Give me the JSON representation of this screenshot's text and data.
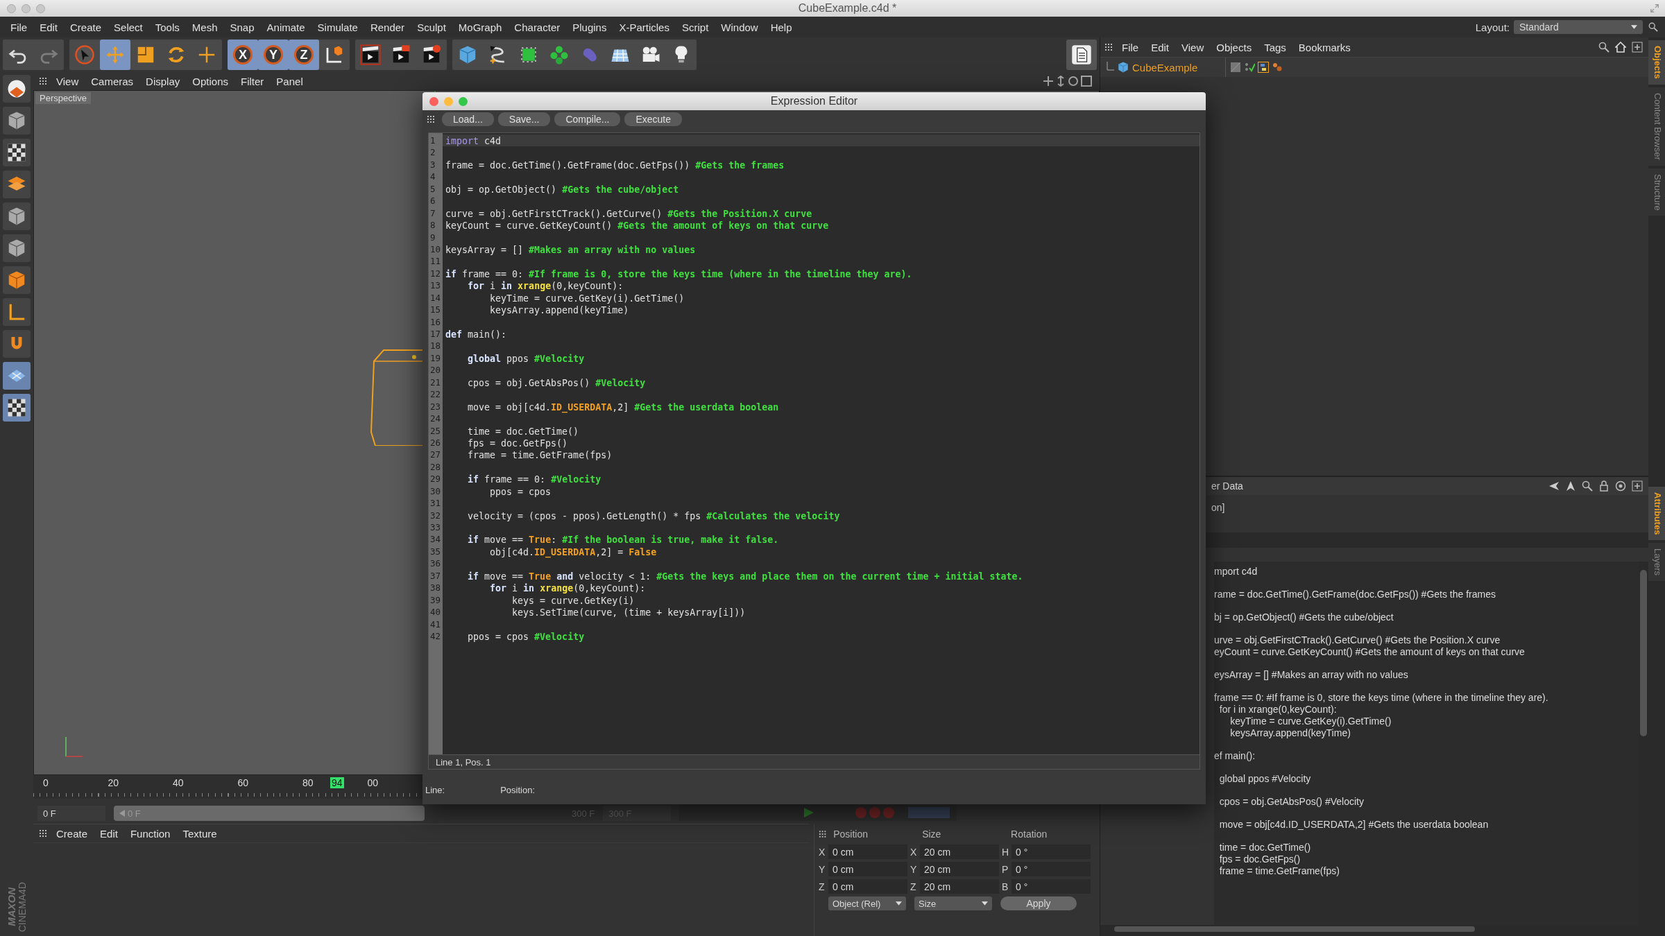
{
  "title_bar": {
    "title": "CubeExample.c4d *"
  },
  "menu_bar": {
    "items": [
      "File",
      "Edit",
      "Create",
      "Select",
      "Tools",
      "Mesh",
      "Snap",
      "Animate",
      "Simulate",
      "Render",
      "Sculpt",
      "MoGraph",
      "Character",
      "Plugins",
      "X-Particles",
      "Script",
      "Window",
      "Help"
    ],
    "layout_label": "Layout:",
    "layout_value": "Standard"
  },
  "toolbar": {
    "groups": [
      [
        {
          "kind": "undo",
          "selected": false,
          "disabled": false
        },
        {
          "kind": "redo",
          "selected": false,
          "disabled": true
        }
      ],
      [
        {
          "kind": "select",
          "selected": false,
          "disabled": false
        },
        {
          "kind": "move",
          "selected": true,
          "disabled": false
        },
        {
          "kind": "scale",
          "selected": false,
          "disabled": false
        },
        {
          "kind": "rotate",
          "selected": false,
          "disabled": false
        },
        {
          "kind": "transform",
          "selected": false,
          "disabled": false
        }
      ],
      [
        {
          "kind": "axis",
          "label": "X",
          "selected": true,
          "disabled": false
        },
        {
          "kind": "axis",
          "label": "Y",
          "selected": true,
          "disabled": false
        },
        {
          "kind": "axis",
          "label": "Z",
          "selected": true,
          "disabled": false
        },
        {
          "kind": "coords",
          "selected": false,
          "disabled": false
        }
      ],
      [
        {
          "kind": "render-view",
          "selected": false,
          "disabled": false
        },
        {
          "kind": "render-picture",
          "selected": false,
          "disabled": false
        },
        {
          "kind": "render-settings",
          "selected": false,
          "disabled": false
        }
      ],
      [
        {
          "kind": "cube",
          "selected": false,
          "disabled": false
        },
        {
          "kind": "pen",
          "selected": false,
          "disabled": false
        },
        {
          "kind": "subdivision",
          "selected": false,
          "disabled": false
        },
        {
          "kind": "cloner",
          "selected": false,
          "disabled": false
        },
        {
          "kind": "deformer",
          "selected": false,
          "disabled": false
        },
        {
          "kind": "floor",
          "selected": false,
          "disabled": false
        },
        {
          "kind": "camera",
          "selected": false,
          "disabled": false
        },
        {
          "kind": "light",
          "selected": false,
          "disabled": false
        }
      ]
    ]
  },
  "viewport": {
    "menu": [
      "View",
      "Cameras",
      "Display",
      "Options",
      "Filter",
      "Panel"
    ],
    "label": "Perspective"
  },
  "timeline": {
    "ticks": [
      "0",
      "20",
      "40",
      "60",
      "80",
      "00"
    ],
    "marker": "94",
    "start_field": "0 F",
    "slider_value": "0 F",
    "level": 1,
    "end_slider": "300 F",
    "end_field": "300 F"
  },
  "material_manager": {
    "menu": [
      "Create",
      "Edit",
      "Function",
      "Texture"
    ]
  },
  "logo": {
    "brand": "MAXON",
    "product": "CINEMA4D"
  },
  "coordinates": {
    "headers": [
      "Position",
      "Size",
      "Rotation"
    ],
    "rows": [
      {
        "axis": "X",
        "position": "0 cm",
        "size_axis": "X",
        "size": "20 cm",
        "rot_axis": "H",
        "rotation": "0 °"
      },
      {
        "axis": "Y",
        "position": "0 cm",
        "size_axis": "Y",
        "size": "20 cm",
        "rot_axis": "P",
        "rotation": "0 °"
      },
      {
        "axis": "Z",
        "position": "0 cm",
        "size_axis": "Z",
        "size": "20 cm",
        "rot_axis": "B",
        "rotation": "0 °"
      }
    ],
    "mode": "Object (Rel)",
    "size_mode": "Size",
    "apply": "Apply"
  },
  "object_manager": {
    "menu": [
      "File",
      "Edit",
      "View",
      "Objects",
      "Tags",
      "Bookmarks"
    ],
    "objects": [
      {
        "name": "CubeExample",
        "active": true
      }
    ]
  },
  "side_tabs_top": [
    {
      "label": "Objects",
      "selected": true
    },
    {
      "label": "Content Browser",
      "selected": false
    },
    {
      "label": "Structure",
      "selected": false
    }
  ],
  "side_tabs_bottom": [
    {
      "label": "Attributes",
      "selected": true
    },
    {
      "label": "Layers",
      "selected": false
    }
  ],
  "attributes": {
    "header": "er Data",
    "field": "on]",
    "code": [
      [
        "mport c4d"
      ],
      [
        "rame = doc.GetTime().GetFrame(doc.GetFps()) #Gets the frames"
      ],
      [
        "bj = op.GetObject() #Gets the cube/object"
      ],
      [
        "urve = obj.GetFirstCTrack().GetCurve() #Gets the Position.X curve",
        "eyCount = curve.GetKeyCount() #Gets the amount of keys on that curve"
      ],
      [
        "eysArray = [] #Makes an array with no values"
      ],
      [
        "frame == 0: #If frame is 0, store the keys time (where in the timeline they are).",
        "  for i in xrange(0,keyCount):",
        "      keyTime = curve.GetKey(i).GetTime()",
        "      keysArray.append(keyTime)"
      ],
      [
        "ef main():"
      ],
      [
        "  global ppos #Velocity"
      ],
      [
        "  cpos = obj.GetAbsPos() #Velocity"
      ],
      [
        "  move = obj[c4d.ID_USERDATA,2] #Gets the userdata boolean"
      ],
      [
        "  time = doc.GetTime()",
        "  fps = doc.GetFps()",
        "  frame = time.GetFrame(fps)"
      ]
    ]
  },
  "editor": {
    "title": "Expression Editor",
    "buttons": [
      "Load...",
      "Save...",
      "Compile...",
      "Execute"
    ],
    "lines": [
      {
        "number": "1",
        "current": true,
        "tokens": [
          {
            "kind": "import",
            "text": "import"
          },
          {
            "kind": "text",
            "text": " c4d"
          }
        ]
      },
      {
        "number": "2",
        "current": false
      },
      {
        "number": "3",
        "current": false,
        "tokens": [
          {
            "kind": "text",
            "text": "frame = doc.GetTime().GetFrame(doc.GetFps()) "
          },
          {
            "kind": "comment",
            "text": "#Gets the frames"
          }
        ]
      },
      {
        "number": "4",
        "current": false
      },
      {
        "number": "5",
        "current": false,
        "tokens": [
          {
            "kind": "text",
            "text": "obj = op.GetObject() "
          },
          {
            "kind": "comment",
            "text": "#Gets the cube/object"
          }
        ]
      },
      {
        "number": "6",
        "current": false
      },
      {
        "number": "7",
        "current": false,
        "tokens": [
          {
            "kind": "text",
            "text": "curve = obj.GetFirstCTrack().GetCurve() "
          },
          {
            "kind": "comment",
            "text": "#Gets the Position.X curve"
          }
        ]
      },
      {
        "number": "8",
        "current": false,
        "tokens": [
          {
            "kind": "text",
            "text": "keyCount = curve.GetKeyCount() "
          },
          {
            "kind": "comment",
            "text": "#Gets the amount of keys on that curve"
          }
        ]
      },
      {
        "number": "9",
        "current": false
      },
      {
        "number": "10",
        "current": false,
        "tokens": [
          {
            "kind": "text",
            "text": "keysArray = [] "
          },
          {
            "kind": "comment",
            "text": "#Makes an array with no values"
          }
        ]
      },
      {
        "number": "11",
        "current": false
      },
      {
        "number": "12",
        "current": false,
        "tokens": [
          {
            "kind": "keyword",
            "text": "if"
          },
          {
            "kind": "text",
            "text": " frame == 0: "
          },
          {
            "kind": "comment",
            "text": "#If frame is 0, store the keys time (where in the timeline they are)."
          }
        ]
      },
      {
        "number": "13",
        "current": false,
        "tokens": [
          {
            "kind": "keyword",
            "text": "    for"
          },
          {
            "kind": "text",
            "text": " i "
          },
          {
            "kind": "keyword",
            "text": "in "
          },
          {
            "kind": "builtin",
            "text": "xrange"
          },
          {
            "kind": "text",
            "text": "(0,keyCount):"
          }
        ]
      },
      {
        "number": "14",
        "current": false,
        "tokens": [
          {
            "kind": "text",
            "text": "        keyTime = curve.GetKey(i).GetTime()"
          }
        ]
      },
      {
        "number": "15",
        "current": false,
        "tokens": [
          {
            "kind": "text",
            "text": "        keysArray.append(keyTime)"
          }
        ]
      },
      {
        "number": "16",
        "current": false
      },
      {
        "number": "17",
        "current": false,
        "tokens": [
          {
            "kind": "keyword",
            "text": "def"
          },
          {
            "kind": "text",
            "text": " main():"
          }
        ]
      },
      {
        "number": "18",
        "current": false
      },
      {
        "number": "19",
        "current": false,
        "tokens": [
          {
            "kind": "keyword",
            "text": "    global"
          },
          {
            "kind": "text",
            "text": " ppos "
          },
          {
            "kind": "comment",
            "text": "#Velocity"
          }
        ]
      },
      {
        "number": "20",
        "current": false
      },
      {
        "number": "21",
        "current": false,
        "tokens": [
          {
            "kind": "text",
            "text": "    cpos = obj.GetAbsPos() "
          },
          {
            "kind": "comment",
            "text": "#Velocity"
          }
        ]
      },
      {
        "number": "22",
        "current": false
      },
      {
        "number": "23",
        "current": false,
        "tokens": [
          {
            "kind": "text",
            "text": "    move = obj[c4d."
          },
          {
            "kind": "constant",
            "text": "ID_USERDATA"
          },
          {
            "kind": "text",
            "text": ",2] "
          },
          {
            "kind": "comment",
            "text": "#Gets the userdata boolean"
          }
        ]
      },
      {
        "number": "24",
        "current": false
      },
      {
        "number": "25",
        "current": false,
        "tokens": [
          {
            "kind": "text",
            "text": "    time = doc.GetTime()"
          }
        ]
      },
      {
        "number": "26",
        "current": false,
        "tokens": [
          {
            "kind": "text",
            "text": "    fps = doc.GetFps()"
          }
        ]
      },
      {
        "number": "27",
        "current": false,
        "tokens": [
          {
            "kind": "text",
            "text": "    frame = time.GetFrame(fps)"
          }
        ]
      },
      {
        "number": "28",
        "current": false
      },
      {
        "number": "29",
        "current": false,
        "tokens": [
          {
            "kind": "keyword",
            "text": "    if"
          },
          {
            "kind": "text",
            "text": " frame == 0: "
          },
          {
            "kind": "comment",
            "text": "#Velocity"
          }
        ]
      },
      {
        "number": "30",
        "current": false,
        "tokens": [
          {
            "kind": "text",
            "text": "        ppos = cpos"
          }
        ]
      },
      {
        "number": "31",
        "current": false
      },
      {
        "number": "32",
        "current": false,
        "tokens": [
          {
            "kind": "text",
            "text": "    velocity = (cpos - ppos).GetLength() * fps "
          },
          {
            "kind": "comment",
            "text": "#Calculates the velocity"
          }
        ]
      },
      {
        "number": "33",
        "current": false
      },
      {
        "number": "34",
        "current": false,
        "tokens": [
          {
            "kind": "keyword",
            "text": "    if"
          },
          {
            "kind": "text",
            "text": " move == "
          },
          {
            "kind": "constant",
            "text": "True"
          },
          {
            "kind": "text",
            "text": ": "
          },
          {
            "kind": "comment",
            "text": "#If the boolean is true, make it false."
          }
        ]
      },
      {
        "number": "35",
        "current": false,
        "tokens": [
          {
            "kind": "text",
            "text": "        obj[c4d."
          },
          {
            "kind": "constant",
            "text": "ID_USERDATA"
          },
          {
            "kind": "text",
            "text": ",2] = "
          },
          {
            "kind": "constant",
            "text": "False"
          }
        ]
      },
      {
        "number": "36",
        "current": false
      },
      {
        "number": "37",
        "current": false,
        "tokens": [
          {
            "kind": "keyword",
            "text": "    if"
          },
          {
            "kind": "text",
            "text": " move == "
          },
          {
            "kind": "constant",
            "text": "True"
          },
          {
            "kind": "keyword",
            "text": " and"
          },
          {
            "kind": "text",
            "text": " velocity < 1: "
          },
          {
            "kind": "comment",
            "text": "#Gets the keys and place them on the current time + initial state."
          }
        ]
      },
      {
        "number": "38",
        "current": false,
        "tokens": [
          {
            "kind": "keyword",
            "text": "        for"
          },
          {
            "kind": "text",
            "text": " i "
          },
          {
            "kind": "keyword",
            "text": "in "
          },
          {
            "kind": "builtin",
            "text": "xrange"
          },
          {
            "kind": "text",
            "text": "(0,keyCount):"
          }
        ]
      },
      {
        "number": "39",
        "current": false,
        "tokens": [
          {
            "kind": "text",
            "text": "            keys = curve.GetKey(i)"
          }
        ]
      },
      {
        "number": "40",
        "current": false,
        "tokens": [
          {
            "kind": "text",
            "text": "            keys.SetTime(curve, (time + keysArray[i]))"
          }
        ]
      },
      {
        "number": "41",
        "current": false
      },
      {
        "number": "42",
        "current": false,
        "tokens": [
          {
            "kind": "text",
            "text": "    ppos = cpos "
          },
          {
            "kind": "comment",
            "text": "#Velocity"
          }
        ]
      }
    ],
    "status": "Line 1, Pos. 1",
    "line_label": "Line:",
    "position_label": "Position:"
  }
}
